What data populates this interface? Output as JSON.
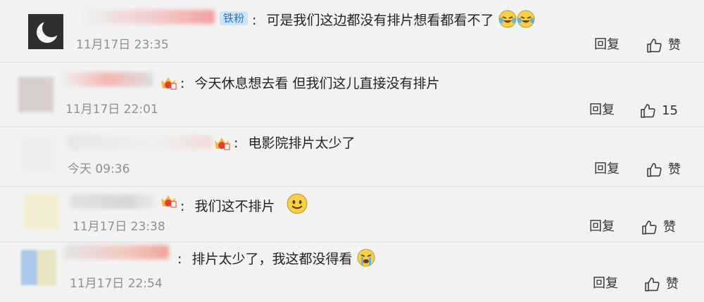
{
  "comments": [
    {
      "badge": "铁粉",
      "separator": ":",
      "text": "可是我们这边都没有排片想看都看不了",
      "emojis": [
        "laugh-cry-emoji",
        "laugh-cry-emoji"
      ],
      "time": "11月17日 23:35",
      "reply_label": "回复",
      "like_label": "赞"
    },
    {
      "separator": ":",
      "text": "今天休息想去看 但我们这儿直接没有排片",
      "time": "11月17日 22:01",
      "reply_label": "回复",
      "like_label": "15"
    },
    {
      "separator": ":",
      "text": "电影院排片太少了",
      "time": "今天 09:36",
      "reply_label": "回复",
      "like_label": "赞"
    },
    {
      "separator": ":",
      "text": "我们这不排片",
      "emojis": [
        "smile-emoji"
      ],
      "time": "11月17日 23:38",
      "reply_label": "回复",
      "like_label": "赞"
    },
    {
      "separator": ":",
      "text": "排片太少了，我这都没得看",
      "emojis": [
        "crying-emoji"
      ],
      "time": "11月17日 22:54",
      "reply_label": "回复",
      "like_label": "赞"
    }
  ],
  "colors": {
    "badge_bg": "#cfe4f6",
    "badge_text": "#2a75c9",
    "time": "#8f8f8f"
  }
}
